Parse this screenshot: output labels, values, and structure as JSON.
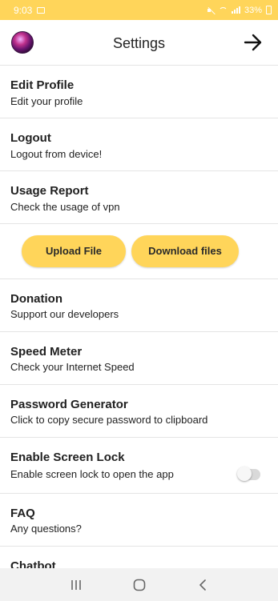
{
  "status_bar": {
    "time": "9:03",
    "battery": "33%"
  },
  "header": {
    "title": "Settings"
  },
  "menu": {
    "edit_profile": {
      "title": "Edit Profile",
      "subtitle": "Edit your profile"
    },
    "logout": {
      "title": "Logout",
      "subtitle": "Logout from device!"
    },
    "usage_report": {
      "title": "Usage Report",
      "subtitle": "Check the usage of vpn"
    },
    "donation": {
      "title": "Donation",
      "subtitle": "Support our developers"
    },
    "speed_meter": {
      "title": "Speed Meter",
      "subtitle": "Check your Internet Speed"
    },
    "password_generator": {
      "title": "Password Generator",
      "subtitle": "Click to copy secure password to clipboard"
    },
    "screen_lock": {
      "title": "Enable Screen Lock",
      "subtitle": "Enable screen lock to open the app",
      "enabled": false
    },
    "faq": {
      "title": "FAQ",
      "subtitle": "Any questions?"
    },
    "chatbot": {
      "title": "Chatbot"
    }
  },
  "buttons": {
    "upload": "Upload File",
    "download": "Download files"
  },
  "colors": {
    "accent": "#FFD55A",
    "divider": "#e4e4e4",
    "text": "#212121"
  },
  "icons": {
    "status_left": [
      "gallery-icon"
    ],
    "status_right": [
      "mute-icon",
      "wifi-icon",
      "signal-icon",
      "battery-icon"
    ],
    "header_right": "arrow-right-icon",
    "nav": [
      "recents-icon",
      "home-icon",
      "back-icon"
    ]
  }
}
